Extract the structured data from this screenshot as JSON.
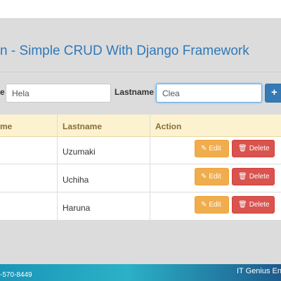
{
  "header": {
    "title": "n - Simple CRUD With Django Framework"
  },
  "form": {
    "firstname_label": "e",
    "firstname_value": "Hela",
    "lastname_label": "Lastname",
    "lastname_value": "Clea",
    "add_button_label": "+"
  },
  "table": {
    "columns": [
      "me",
      "Lastname",
      "Action"
    ],
    "rows": [
      {
        "lastname": "Uzumaki",
        "edit_label": "Edit",
        "delete_label": "Delete"
      },
      {
        "lastname": "Uchiha",
        "edit_label": "Edit",
        "delete_label": "Delete"
      },
      {
        "lastname": "Haruna",
        "edit_label": "Edit",
        "delete_label": "Delete"
      }
    ]
  },
  "footer": {
    "phone": "-570-8449",
    "brand": "IT Genius Eng"
  },
  "icons": {
    "edit": "edit-icon",
    "delete": "trash-icon"
  },
  "colors": {
    "title": "#2f79b9",
    "primary": "#337ab7",
    "warning": "#f0ad4e",
    "danger": "#d9534f",
    "table_header_bg": "#fcf2cf",
    "table_header_text": "#8a6d3b"
  }
}
